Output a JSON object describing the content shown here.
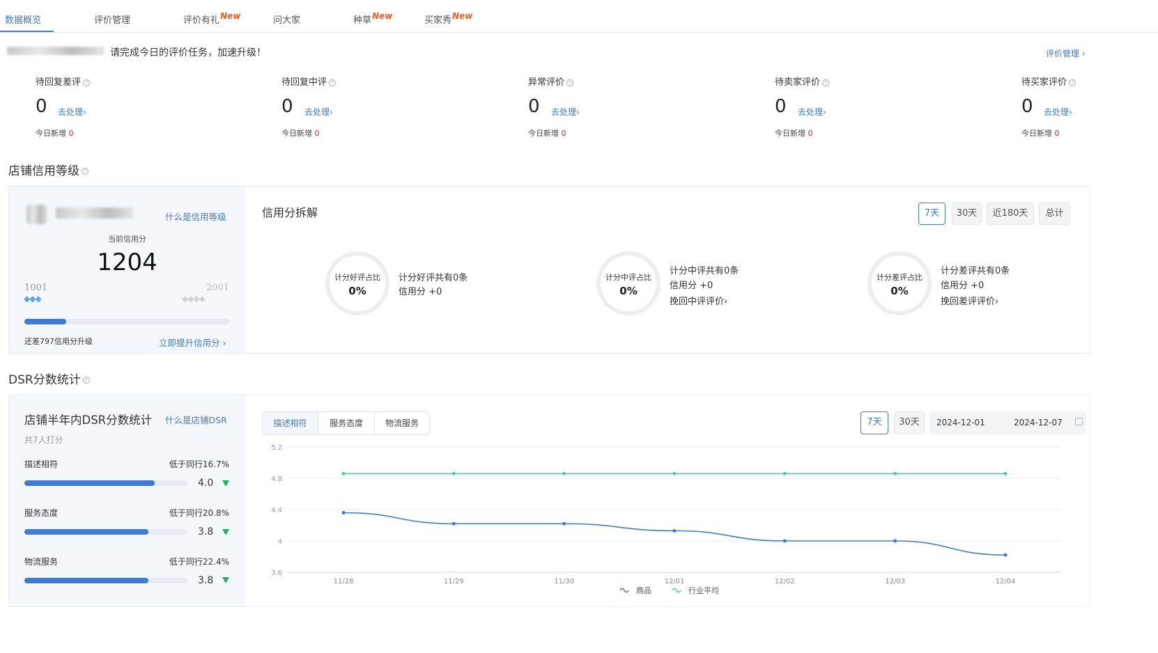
{
  "tabs": [
    {
      "label": "数据概览",
      "badge": ""
    },
    {
      "label": "评价管理",
      "badge": ""
    },
    {
      "label": "评价有礼",
      "badge": "New"
    },
    {
      "label": "问大家",
      "badge": ""
    },
    {
      "label": "种草",
      "badge": "New"
    },
    {
      "label": "买家秀",
      "badge": "New"
    }
  ],
  "notice": {
    "text": "请完成今日的评价任务，加速升级！",
    "link": "评价管理"
  },
  "pending": [
    {
      "title": "待回复差评",
      "count": "0",
      "action": "去处理",
      "new_label": "今日新增",
      "new_count": "0"
    },
    {
      "title": "待回复中评",
      "count": "0",
      "action": "去处理",
      "new_label": "今日新增",
      "new_count": "0"
    },
    {
      "title": "异常评价",
      "count": "0",
      "action": "去处理",
      "new_label": "今日新增",
      "new_count": "0"
    },
    {
      "title": "待卖家评价",
      "count": "0",
      "action": "去处理",
      "new_label": "今日新增",
      "new_count": "0"
    },
    {
      "title": "待买家评价",
      "count": "0",
      "action": "去处理",
      "new_label": "今日新增",
      "new_count": "0"
    }
  ],
  "credit": {
    "section_title": "店铺信用等级",
    "what_link": "什么是信用等级",
    "score_label": "当前信用分",
    "score": "1204",
    "min_label": "1001",
    "max_label": "2001",
    "progress": 0.203,
    "gap_text": "还差797信用分升级",
    "improve_link": "立即提升信用分",
    "breakdown_title": "信用分拆解",
    "periods": [
      "7天",
      "30天",
      "近180天",
      "总计"
    ],
    "rings": [
      {
        "label": "计分好评占比",
        "value": "0%",
        "line1": "计分好评共有0条",
        "line2": "信用分 +0",
        "link": ""
      },
      {
        "label": "计分中评占比",
        "value": "0%",
        "line1": "计分中评共有0条",
        "line2": "信用分 +0",
        "link": "挽回中评评价"
      },
      {
        "label": "计分差评占比",
        "value": "0%",
        "line1": "计分差评共有0条",
        "line2": "信用分 +0",
        "link": "挽回差评评价"
      }
    ]
  },
  "dsr": {
    "section_title": "DSR分数统计",
    "panel_title": "店铺半年内DSR分数统计",
    "what_link": "什么是店铺DSR",
    "raters": "共7人打分",
    "items": [
      {
        "name": "描述相符",
        "compare": "低于同行16.7%",
        "score": "4.0",
        "fill": 0.8
      },
      {
        "name": "服务态度",
        "compare": "低于同行20.8%",
        "score": "3.8",
        "fill": 0.76
      },
      {
        "name": "物流服务",
        "compare": "低于同行22.4%",
        "score": "3.8",
        "fill": 0.76
      }
    ],
    "chart_tabs": [
      "描述相符",
      "服务态度",
      "物流服务"
    ],
    "periods": [
      "7天",
      "30天"
    ],
    "date_start": "2024-12-01",
    "date_end": "2024-12-07"
  },
  "colors": {
    "accent": "#3e7bd6",
    "industry": "#4ccfa2",
    "new_badge": "#f25a1f"
  },
  "chart_data": {
    "type": "line",
    "categories": [
      "11/28",
      "11/29",
      "11/30",
      "12/01",
      "12/02",
      "12/03",
      "12/04"
    ],
    "series": [
      {
        "name": "商品",
        "values": [
          4.36,
          4.22,
          4.22,
          4.13,
          4.0,
          4.0,
          3.82
        ]
      },
      {
        "name": "行业平均",
        "values": [
          4.86,
          4.86,
          4.86,
          4.86,
          4.86,
          4.86,
          4.86
        ]
      }
    ],
    "y_ticks": [
      "5.2",
      "4.8",
      "4.4",
      "4",
      "3.6"
    ],
    "ylim": [
      3.6,
      5.2
    ],
    "grid": true,
    "legend": "bottom"
  }
}
